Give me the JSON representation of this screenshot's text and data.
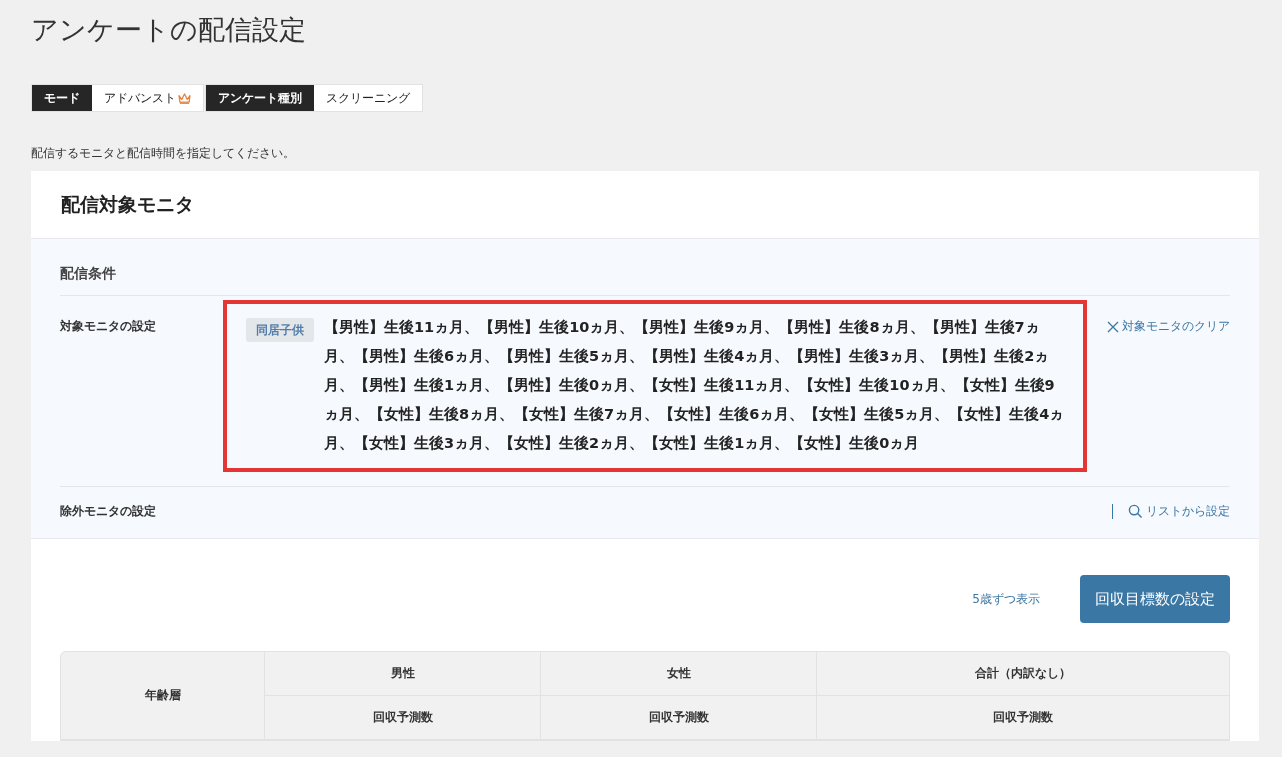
{
  "page_title": "アンケートの配信設定",
  "toggles": [
    {
      "label": "モード",
      "value": "アドバンスト",
      "premium": true
    },
    {
      "label": "アンケート種別",
      "value": "スクリーニング",
      "premium": false
    }
  ],
  "instruction": "配信するモニタと配信時間を指定してください。",
  "card": {
    "title": "配信対象モニタ",
    "conditions": {
      "title": "配信条件",
      "target": {
        "label": "対象モニタの設定",
        "tag": "同居子供",
        "text": "【男性】生後11ヵ月、【男性】生後10ヵ月、【男性】生後9ヵ月、【男性】生後8ヵ月、【男性】生後7ヵ月、【男性】生後6ヵ月、【男性】生後5ヵ月、【男性】生後4ヵ月、【男性】生後3ヵ月、【男性】生後2ヵ月、【男性】生後1ヵ月、【男性】生後0ヵ月、【女性】生後11ヵ月、【女性】生後10ヵ月、【女性】生後9ヵ月、【女性】生後8ヵ月、【女性】生後7ヵ月、【女性】生後6ヵ月、【女性】生後5ヵ月、【女性】生後4ヵ月、【女性】生後3ヵ月、【女性】生後2ヵ月、【女性】生後1ヵ月、【女性】生後0ヵ月",
        "highlighted": true,
        "clear_link": "対象モニタのクリア"
      },
      "exclude": {
        "label": "除外モニタの設定",
        "list_link": "リストから設定"
      }
    },
    "age_link": "5歳ずつ表示",
    "target_button": "回収目標数の設定",
    "table": {
      "row_header": "年齢層",
      "columns": [
        {
          "label": "男性",
          "sub": "回収予測数"
        },
        {
          "label": "女性",
          "sub": "回収予測数"
        },
        {
          "label": "合計（内訳なし）",
          "sub": "回収予測数"
        }
      ]
    }
  }
}
